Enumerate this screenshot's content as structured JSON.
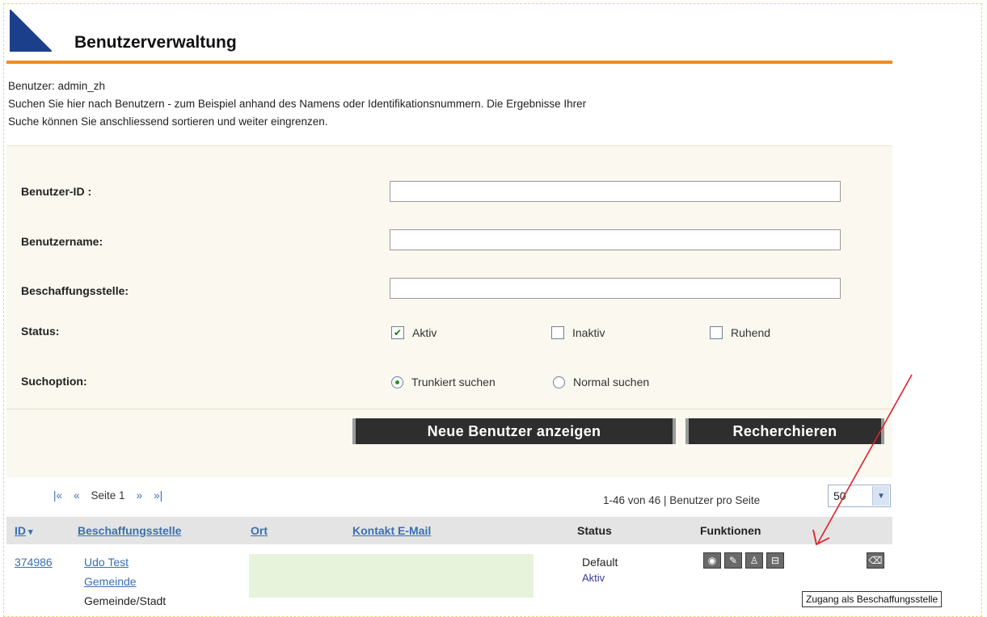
{
  "header": {
    "title": "Benutzerverwaltung"
  },
  "intro": {
    "user_line": "Benutzer: admin_zh",
    "text_line1": "Suchen Sie hier nach Benutzern - zum Beispiel anhand des Namens oder Identifikationsnummern. Die Ergebnisse Ihrer",
    "text_line2": "Suche können Sie anschliessend sortieren und weiter eingrenzen."
  },
  "form": {
    "user_id_label": "Benutzer-ID :",
    "user_id_value": "",
    "username_label": "Benutzername:",
    "username_value": "",
    "office_label": "Beschaffungsstelle:",
    "office_value": "",
    "status_label": "Status:",
    "status_options": [
      {
        "label": "Aktiv",
        "checked": true
      },
      {
        "label": "Inaktiv",
        "checked": false
      },
      {
        "label": "Ruhend",
        "checked": false
      }
    ],
    "search_option_label": "Suchoption:",
    "search_options": [
      {
        "label": "Trunkiert suchen",
        "selected": true
      },
      {
        "label": "Normal suchen",
        "selected": false
      }
    ],
    "new_users_button": "Neue Benutzer anzeigen",
    "search_button": "Recherchieren"
  },
  "pager": {
    "first": "|«",
    "prev": "«",
    "page_label": "Seite 1",
    "next": "»",
    "last": "»|",
    "range": "1-46 von 46 | Benutzer pro Seite",
    "per_page_value": "50"
  },
  "table": {
    "headers": {
      "id": "ID",
      "sort_indicator": "▾",
      "office": "Beschaffungsstelle",
      "city": "Ort",
      "email": "Kontakt E-Mail",
      "status": "Status",
      "functions": "Funktionen"
    },
    "rows": [
      {
        "id": "374986",
        "name": "Udo Test",
        "office_link": "Gemeinde",
        "office_type": "Gemeinde/Stadt",
        "status_main": "Default",
        "status_sub": "Aktiv"
      }
    ]
  },
  "tooltip": "Zugang als Beschaffungsstelle",
  "colors": {
    "accent_orange": "#f08c1e",
    "link_blue": "#3a6fb0",
    "panel_bg": "#faf8ef",
    "email_cell_bg": "#e8f3dc"
  }
}
